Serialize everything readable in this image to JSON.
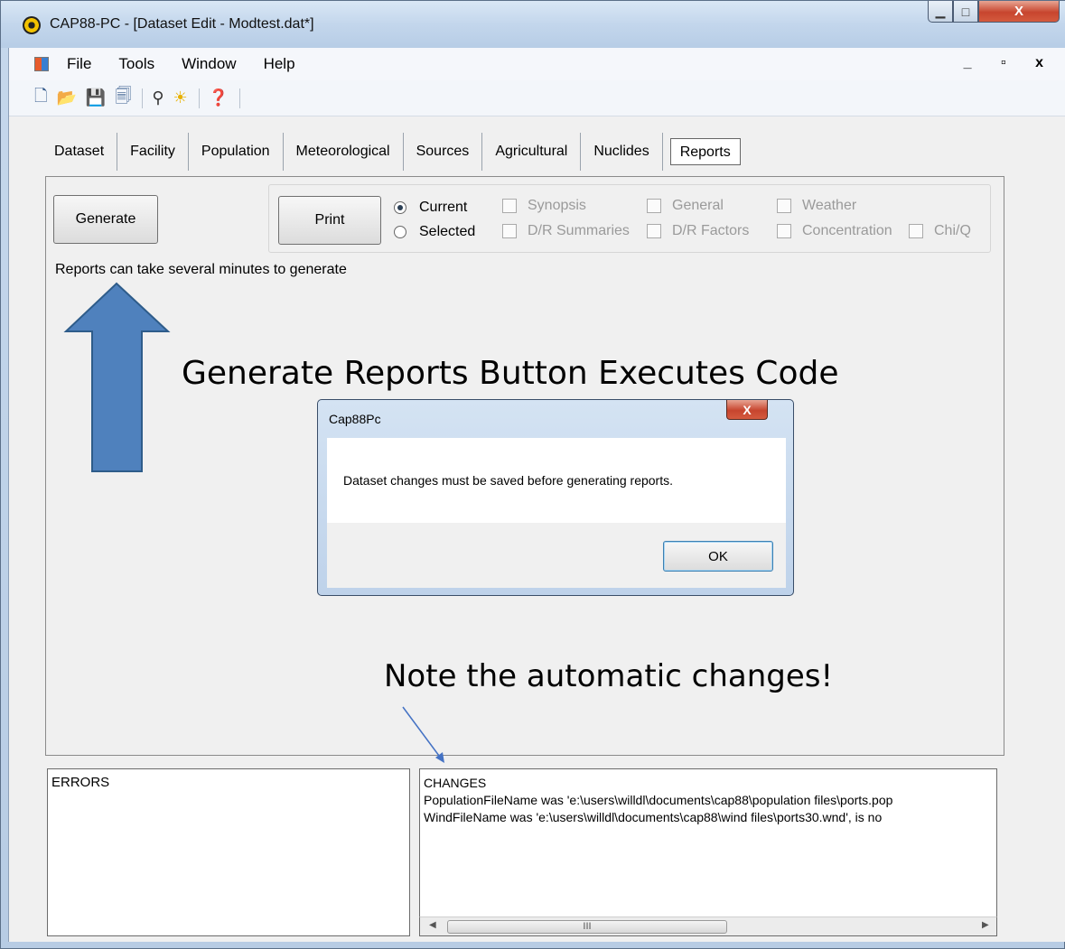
{
  "window": {
    "title": "CAP88-PC - [Dataset Edit - Modtest.dat*]",
    "close_glyph": "X",
    "min_glyph": "▁",
    "max_glyph": "□"
  },
  "menu": {
    "items": [
      "File",
      "Tools",
      "Window",
      "Help"
    ],
    "mdi_controls": "_ ▫ x"
  },
  "tabs": [
    "Dataset",
    "Facility",
    "Population",
    "Meteorological",
    "Sources",
    "Agricultural",
    "Nuclides",
    "Reports"
  ],
  "active_tab": "Reports",
  "reports": {
    "generate_label": "Generate",
    "print_label": "Print",
    "radio_current": "Current",
    "radio_selected": "Selected",
    "checks": {
      "synopsis": "Synopsis",
      "general": "General",
      "weather": "Weather",
      "dr_summaries": "D/R Summaries",
      "dr_factors": "D/R Factors",
      "concentration": "Concentration",
      "chiq": "Chi/Q"
    },
    "note": "Reports can take several minutes to generate"
  },
  "callouts": {
    "generate": "Generate Reports Button Executes Code",
    "changes": "Note the automatic changes!"
  },
  "dialog": {
    "title": "Cap88Pc",
    "message": "Dataset changes must be saved before generating reports.",
    "ok_label": "OK",
    "close_glyph": "X"
  },
  "errors_label": "ERRORS",
  "changes": {
    "label": "CHANGES",
    "lines": [
      "PopulationFileName was 'e:\\users\\willdl\\documents\\cap88\\population files\\ports.pop",
      "WindFileName was 'e:\\users\\willdl\\documents\\cap88\\wind files\\ports30.wnd', is no"
    ],
    "thumb_grip": "III"
  },
  "colors": {
    "arrow_fill": "#4f81bd",
    "arrow_stroke": "#2e5c8a",
    "callout_line": "#4472c4"
  }
}
